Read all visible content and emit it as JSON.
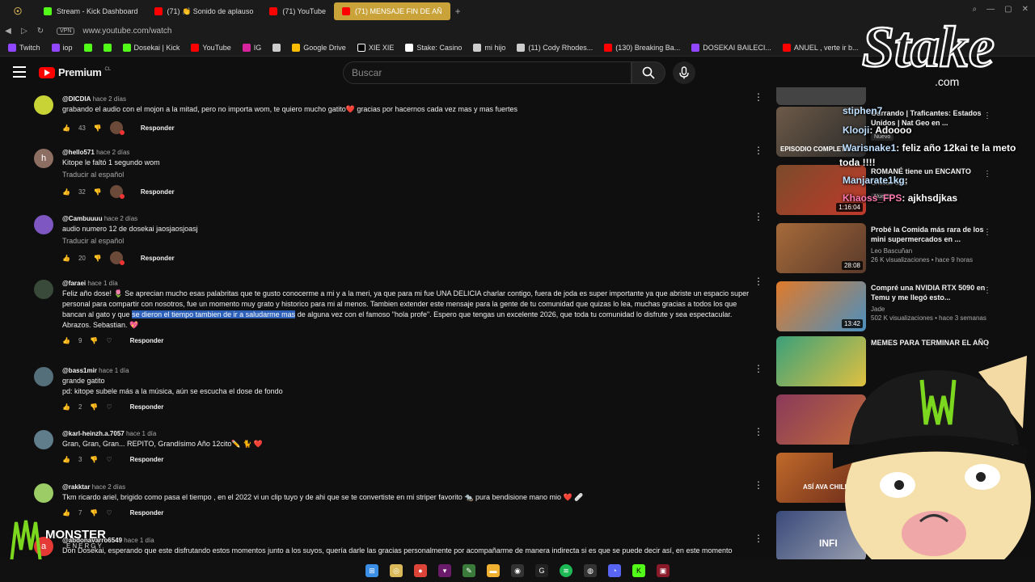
{
  "browser": {
    "tabs": [
      {
        "label": "Stream - Kick Dashboard",
        "color": "#53fc18"
      },
      {
        "label": "(71) 👏 Sonido de aplauso",
        "color": "#ff0000"
      },
      {
        "label": "(71) YouTube",
        "color": "#ff0000"
      },
      {
        "label": "(71) MENSAJE FIN DE AÑ",
        "color": "#ff0000",
        "active": true
      }
    ],
    "url": "www.youtube.com/watch",
    "vpn_label": "VPN",
    "bookmarks": [
      "Twitch",
      "iop",
      "",
      "",
      "Dosekai | Kick",
      "YouTube",
      "IG",
      "",
      "Google Drive",
      "XIE XIE",
      "Stake: Casino",
      "mi hijo",
      "(11) Cody Rhodes...",
      "(130) Breaking Ba...",
      "DOSEKAI BAILECI...",
      "ANUEL , verte ir b..."
    ]
  },
  "youtube": {
    "logo_text": "Premium",
    "country": "CL",
    "search_placeholder": "Buscar"
  },
  "comments": [
    {
      "user": "@DICDIA",
      "time": "hace 2 días",
      "text": "grabando el audio con el mojon a la mitad, pero no importa wom, te quiero mucho gatito❤️ gracias por hacernos cada vez mas y mas fuertes",
      "likes": "43",
      "reply": "Responder",
      "avatar_color": "#c8d436"
    },
    {
      "user": "@hello571",
      "time": "hace 2 días",
      "text": "Kitope le faltó 1 segundo wom",
      "translate": "Traducir al español",
      "likes": "32",
      "reply": "Responder",
      "avatar_letter": "h",
      "avatar_color": "#8d6e63"
    },
    {
      "user": "@Cambuuuu",
      "time": "hace 2 días",
      "text": "audio numero 12 de dosekai jaosjaosjoasj",
      "translate": "Traducir al español",
      "likes": "20",
      "reply": "Responder",
      "avatar_color": "#7e57c2"
    },
    {
      "user": "@faraei",
      "time": "hace 1 día",
      "text_before": "Feliz año dose! 🌷 Se aprecian mucho esas palabritas que te gusto conocerme a mi y a la meri, ya que para mi fue UNA DELICIA charlar contigo, fuera de joda es super importante ya que abriste un espacio super personal para compartir con nosotros, fue un momento muy grato y historico para mi al menos. Tambien extender este mensaje para la gente de tu comunidad que quizas lo lea, muchas gracias a todos los que bancan al gato y que ",
      "text_highlight": "se dieron el tiempo tambien de ir a saludarme mas",
      "text_after": " de alguna vez con el famoso \"hola profe\". Espero que tengas un excelente 2026, que toda tu comunidad lo disfrute y sea espectacular. Abrazos. Sebastian. 💖",
      "likes": "9",
      "reply": "Responder",
      "avatar_color": "#3a4a3a"
    },
    {
      "user": "@bass1mir",
      "time": "hace 1 día",
      "text": "grande gatito",
      "text2": "pd: kitope subele más a la música, aún se escucha el dose de fondo",
      "likes": "2",
      "reply": "Responder",
      "avatar_color": "#546e7a"
    },
    {
      "user": "@karl-heinzh.a.7057",
      "time": "hace 1 día",
      "text": "Gran, Gran, Gran... REPITO, Grandísimo Año 12cito✏️ 🐈 ❤️",
      "likes": "3",
      "reply": "Responder",
      "avatar_color": "#607d8b"
    },
    {
      "user": "@rakktar",
      "time": "hace 2 días",
      "text": "Tkm ricardo ariel, brigido como pasa el tiempo , en el 2022 vi un clip tuyo y de ahi que se te convertiste en mi striper favorito 🐀 pura bendisione mano mio ❤️ 🩹",
      "likes": "7",
      "reply": "Responder",
      "avatar_color": "#9ccc65"
    },
    {
      "user": "@abdonavarro6549",
      "time": "hace 1 día",
      "text": "Don Dosekai, esperando que este disfrutando estos momentos junto a los suyos, quería darle las gracias personalmente por acompañarme de manera indirecta si es que se puede decir así, en este momento",
      "avatar_color": "#e53935",
      "avatar_letter": "a"
    }
  ],
  "sidebar": [
    {
      "title": "",
      "meta1": "",
      "meta2": "",
      "thumb": "#444"
    },
    {
      "title": "Gurrando | Traficantes: Estados Unidos | Nat Geo en ...",
      "meta1": "",
      "meta2": "Nuevo",
      "thumb_label": "EPISODIO COMPLETO",
      "thumb": "#6d5a48"
    },
    {
      "title": "ROMANÉ tiene un ENCANTO",
      "meta1": "Críticas OLS",
      "meta2": "Nuevo",
      "duration": "1:16:04",
      "thumb": "#7b4b2a"
    },
    {
      "title": "Probé la Comida más rara de los mini supermercados en ...",
      "meta1": "Leo Bascuñan",
      "meta2": "26 K visualizaciones • hace 9 horas",
      "duration": "28:08",
      "thumb": "#a66a3a"
    },
    {
      "title": "Compré una NVIDIA RTX 5090 en Temu y me llegó esto...",
      "meta1": "Jade",
      "meta2": "502 K visualizaciones • hace 3 semanas",
      "duration": "13:42",
      "thumb": "#e07a2a"
    },
    {
      "title": "MEMES PARA TERMINAR EL AÑO",
      "meta1": "",
      "meta2": "",
      "thumb": "#3aa07a"
    },
    {
      "title": "",
      "meta1": "",
      "meta2": "",
      "thumb": "#8a3a5a"
    },
    {
      "title": "",
      "meta1": "",
      "meta2": "",
      "thumb_label": "ASÍ AVA CHILE",
      "thumb": "#c06a2a"
    },
    {
      "title": "",
      "meta1": "",
      "meta2": "",
      "thumb_label": "INFI",
      "thumb": "#3a4a7a"
    }
  ],
  "chat": [
    {
      "user": "stiphen7",
      "msg": ""
    },
    {
      "user": "Klooji",
      "msg": ": Adoooo"
    },
    {
      "user": "Warisnake1",
      "msg": ": feliz año 12kai te la meto"
    },
    {
      "user": "",
      "msg": "toda !!!!"
    },
    {
      "user": "Manjarate1kg",
      "msg": ":"
    },
    {
      "user": "Khaoss_FPS",
      "msg": ": ajkhsdjkas"
    }
  ],
  "overlay": {
    "stake": "Stake",
    "stake_com": ".com",
    "monster": "MONSTER",
    "monster_sub": "ENERGY"
  },
  "colors": {
    "accent": "#ff0000",
    "kick": "#53fc18",
    "highlight": "#2b5fb8"
  }
}
